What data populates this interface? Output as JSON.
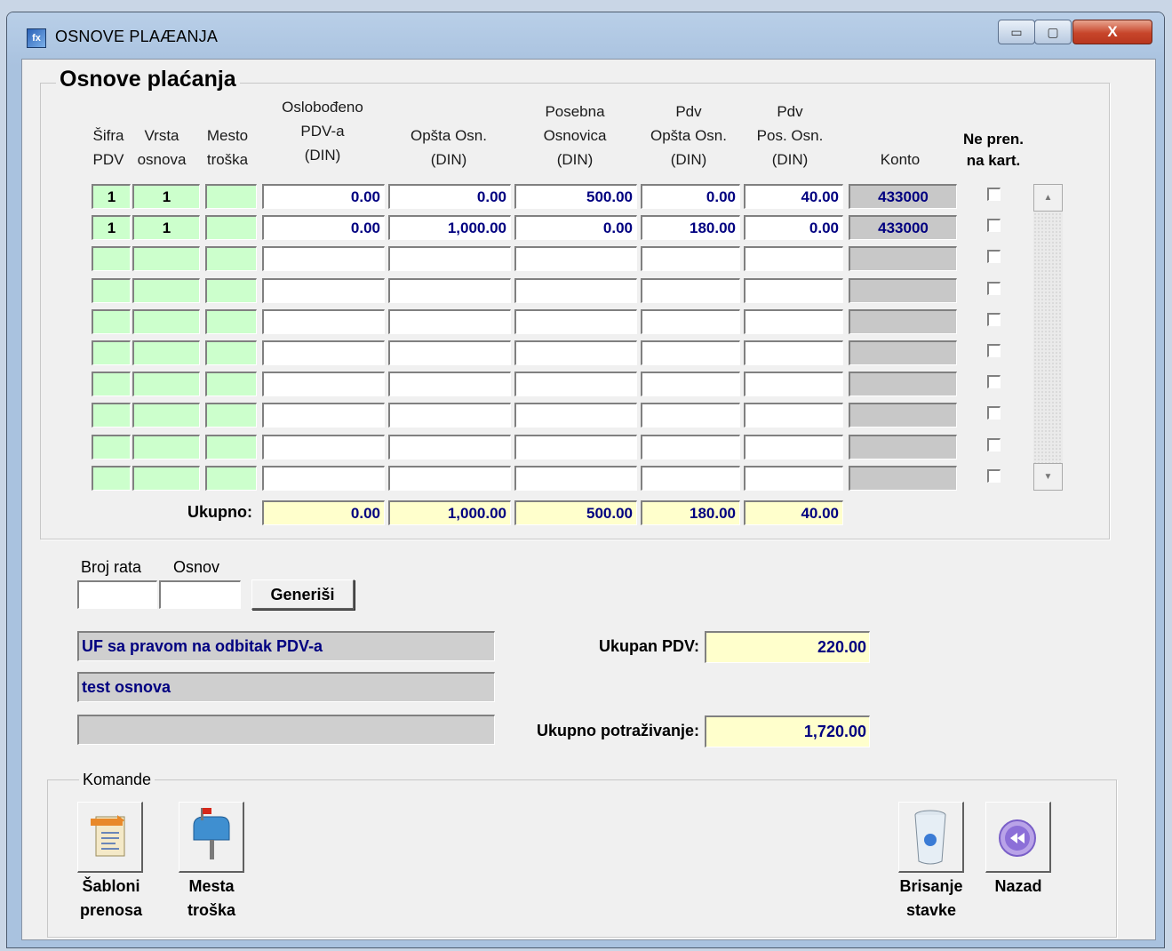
{
  "window": {
    "title": "OSNOVE PLAÆANJA",
    "app_icon": "app-icon",
    "min": "▭",
    "max": "▢",
    "close": "X"
  },
  "grid": {
    "title": "Osnove plaćanja",
    "headers": {
      "sifra": "Šifra\nPDV",
      "vrsta": "Vrsta\nosnova",
      "mesto": "Mesto\ntroška",
      "oslobodjeno": "Oslobođeno\nPDV-a\n(DIN)",
      "opsta": "Opšta Osn.\n(DIN)",
      "posebna": "Posebna\nOsnovica\n(DIN)",
      "pdv_opsta": "Pdv\nOpšta Osn.\n(DIN)",
      "pdv_pos": "Pdv\nPos. Osn.\n(DIN)",
      "konto": "Konto",
      "ne_pren": "Ne pren.\nna kart."
    },
    "rows": [
      {
        "sifra": "1",
        "vrsta": "1",
        "mesto": "",
        "oslobodjeno": "0.00",
        "opsta": "0.00",
        "posebna": "500.00",
        "pdv_opsta": "0.00",
        "pdv_pos": "40.00",
        "konto": "433000"
      },
      {
        "sifra": "1",
        "vrsta": "1",
        "mesto": "",
        "oslobodjeno": "0.00",
        "opsta": "1,000.00",
        "posebna": "0.00",
        "pdv_opsta": "180.00",
        "pdv_pos": "0.00",
        "konto": "433000"
      },
      {
        "sifra": "",
        "vrsta": "",
        "mesto": "",
        "oslobodjeno": "",
        "opsta": "",
        "posebna": "",
        "pdv_opsta": "",
        "pdv_pos": "",
        "konto": ""
      },
      {
        "sifra": "",
        "vrsta": "",
        "mesto": "",
        "oslobodjeno": "",
        "opsta": "",
        "posebna": "",
        "pdv_opsta": "",
        "pdv_pos": "",
        "konto": ""
      },
      {
        "sifra": "",
        "vrsta": "",
        "mesto": "",
        "oslobodjeno": "",
        "opsta": "",
        "posebna": "",
        "pdv_opsta": "",
        "pdv_pos": "",
        "konto": ""
      },
      {
        "sifra": "",
        "vrsta": "",
        "mesto": "",
        "oslobodjeno": "",
        "opsta": "",
        "posebna": "",
        "pdv_opsta": "",
        "pdv_pos": "",
        "konto": ""
      },
      {
        "sifra": "",
        "vrsta": "",
        "mesto": "",
        "oslobodjeno": "",
        "opsta": "",
        "posebna": "",
        "pdv_opsta": "",
        "pdv_pos": "",
        "konto": ""
      },
      {
        "sifra": "",
        "vrsta": "",
        "mesto": "",
        "oslobodjeno": "",
        "opsta": "",
        "posebna": "",
        "pdv_opsta": "",
        "pdv_pos": "",
        "konto": ""
      },
      {
        "sifra": "",
        "vrsta": "",
        "mesto": "",
        "oslobodjeno": "",
        "opsta": "",
        "posebna": "",
        "pdv_opsta": "",
        "pdv_pos": "",
        "konto": ""
      },
      {
        "sifra": "",
        "vrsta": "",
        "mesto": "",
        "oslobodjeno": "",
        "opsta": "",
        "posebna": "",
        "pdv_opsta": "",
        "pdv_pos": "",
        "konto": ""
      }
    ],
    "totals_label": "Ukupno:",
    "totals": {
      "oslobodjeno": "0.00",
      "opsta": "1,000.00",
      "posebna": "500.00",
      "pdv_opsta": "180.00",
      "pdv_pos": "40.00"
    }
  },
  "generate": {
    "broj_rata_label": "Broj rata",
    "osnov_label": "Osnov",
    "broj_rata_value": "",
    "osnov_value": "",
    "button": "Generiši"
  },
  "descriptions": [
    "UF sa pravom na odbitak PDV-a",
    "test osnova",
    ""
  ],
  "summary": {
    "pdv_label": "Ukupan PDV:",
    "pdv_value": "220.00",
    "potrazivanje_label": "Ukupno potraživanje:",
    "potrazivanje_value": "1,720.00"
  },
  "commands": {
    "title": "Komande",
    "sabloni": {
      "label": "Šabloni\nprenosa",
      "icon": "document-template-icon"
    },
    "mesta": {
      "label": "Mesta\ntroška",
      "icon": "mailbox-icon"
    },
    "brisanje": {
      "label": "Brisanje\nstavke",
      "icon": "recycle-bin-icon"
    },
    "nazad": {
      "label": "Nazad",
      "icon": "rewind-icon"
    }
  },
  "colors": {
    "input_green": "#ccffcc",
    "total_yellow": "#ffffcc",
    "value_blue": "#000080",
    "readonly_gray": "#c8c8c8"
  }
}
